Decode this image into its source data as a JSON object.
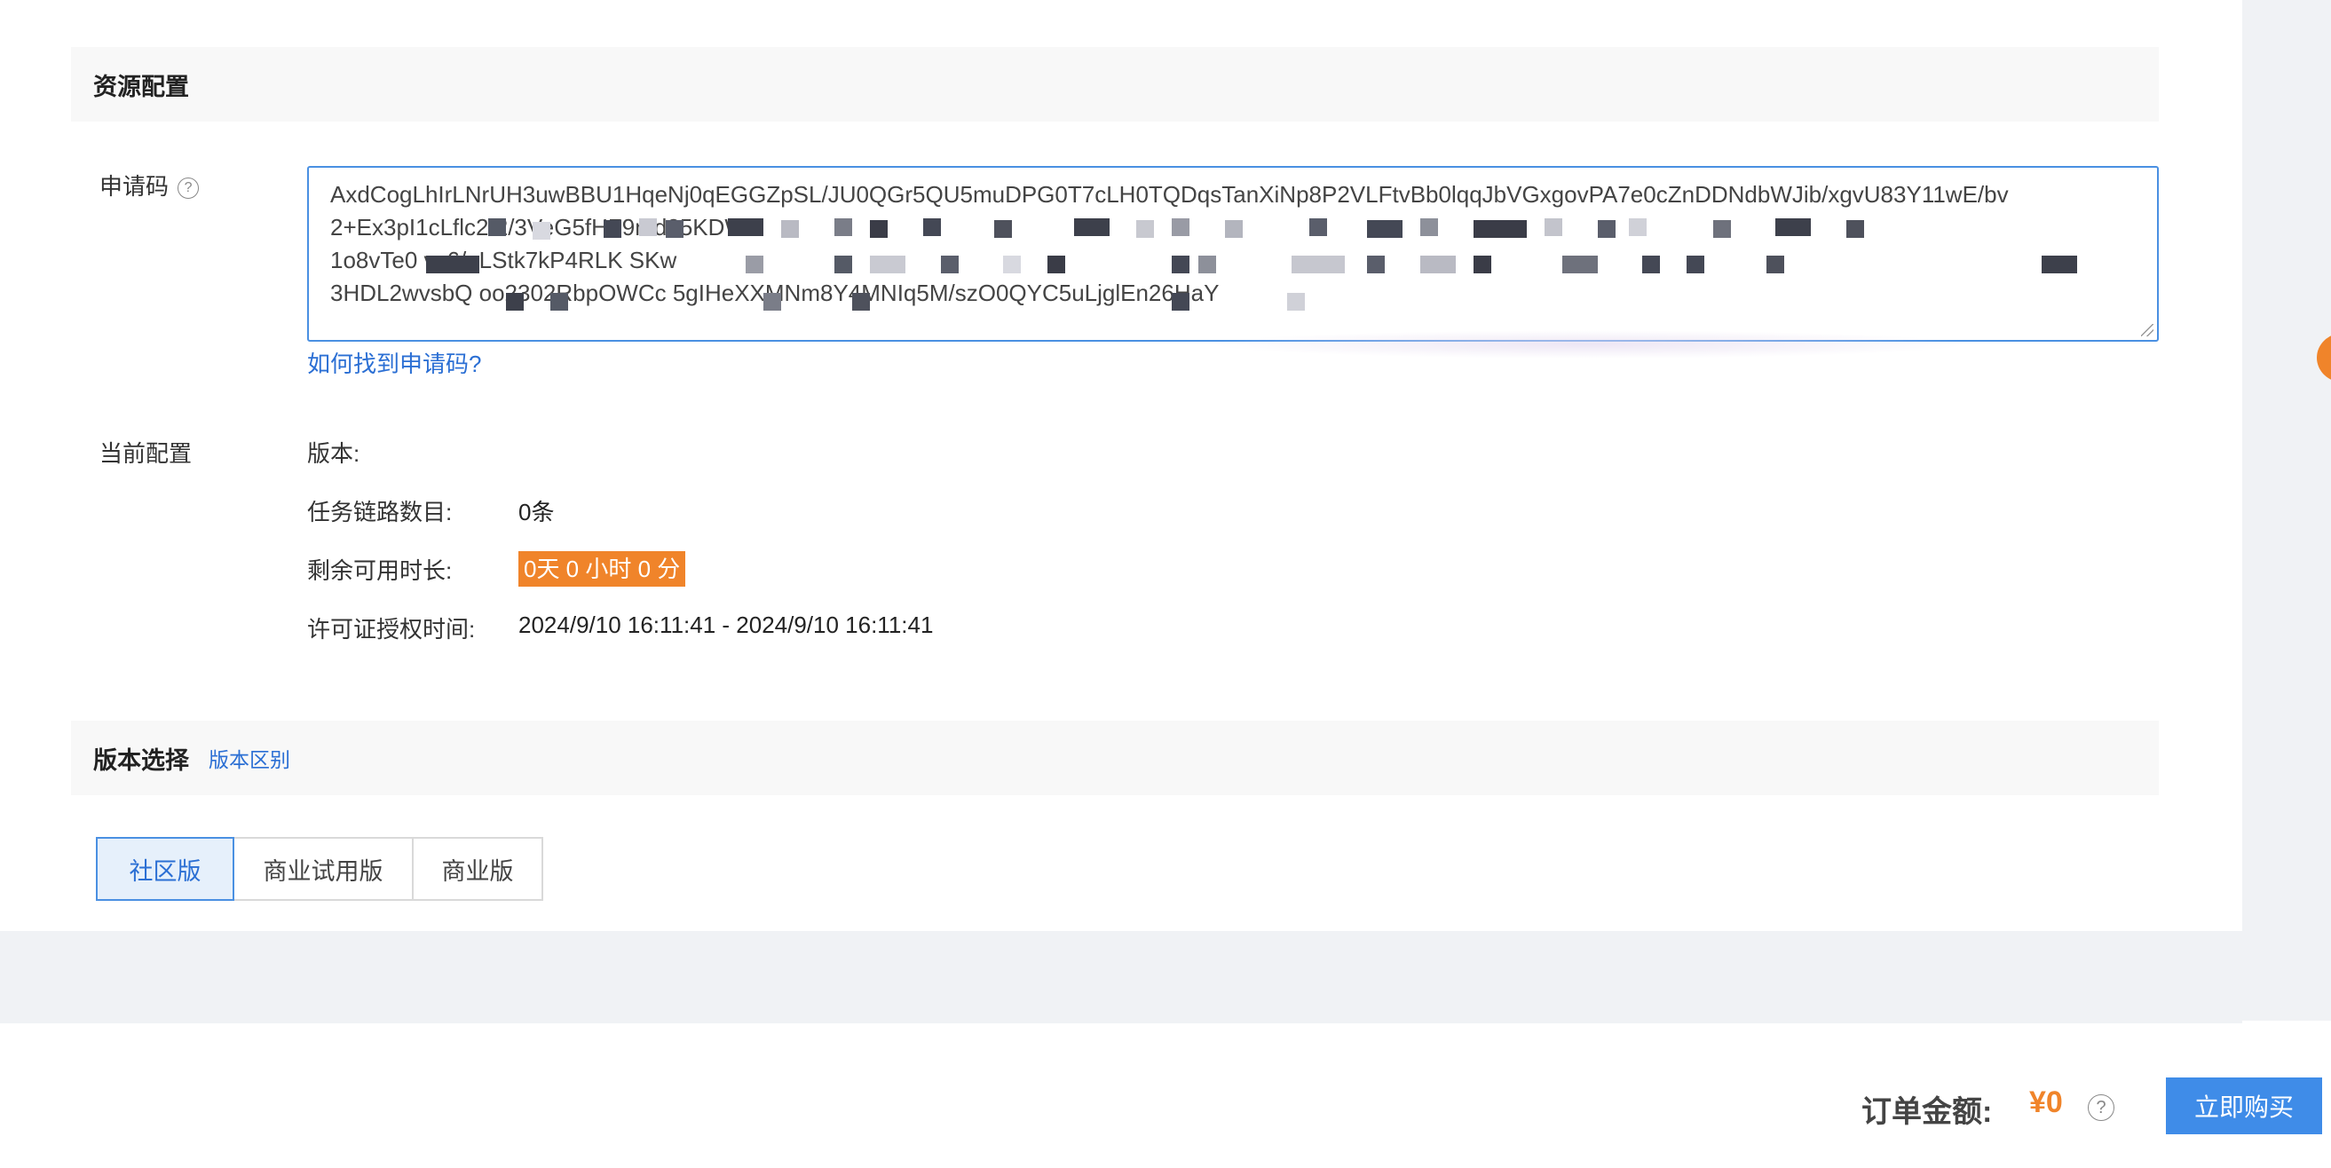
{
  "resource_section": {
    "title": "资源配置"
  },
  "apply_code": {
    "label": "申请码",
    "lines": [
      "AxdCogLhIrLNrUH3uwBBU1HqeNj0qEGGZpSL/JU0QGr5QU5muDPG0T7cLH0TQDqsTanXiNp8P2VLFtvBb0lqqJbVGxgovPA7e0cZnDDNdbWJib/xgvU83Y11wE/bv",
      "2+Ex3pI1cLflc2                                                                   2/3VeG5fHF9md25KDWV",
      "1o8vTe0           vc6/eLStk7kP4RLK                                                                    SKw",
      "3HDL2wvsbQ                  oo2302RbpOWCc                       5gIHeXXMNm8Y4MNIq5M/szO0QYC5uLjglEn26HaY"
    ],
    "help_link": "如何找到申请码?"
  },
  "current_config": {
    "label": "当前配置",
    "version_label": "版本:",
    "task_chain_label": "任务链路数目:",
    "task_chain_value": "0条",
    "remaining_label": "剩余可用时长:",
    "remaining_value": "0天 0 小时 0 分",
    "license_label": "许可证授权时间:",
    "license_value": "2024/9/10 16:11:41 - 2024/9/10 16:11:41"
  },
  "version_section": {
    "title": "版本选择",
    "diff_link": "版本区别",
    "tabs": [
      "社区版",
      "商业试用版",
      "商业版"
    ],
    "selected": "社区版"
  },
  "footer": {
    "total_label": "订单金额:",
    "total_value": "¥0",
    "help_icon": "?",
    "buy_label": "立即购买"
  },
  "colors": {
    "accent": "#3f8ce8",
    "link": "#2b6fd4",
    "orange": "#f0842a"
  }
}
